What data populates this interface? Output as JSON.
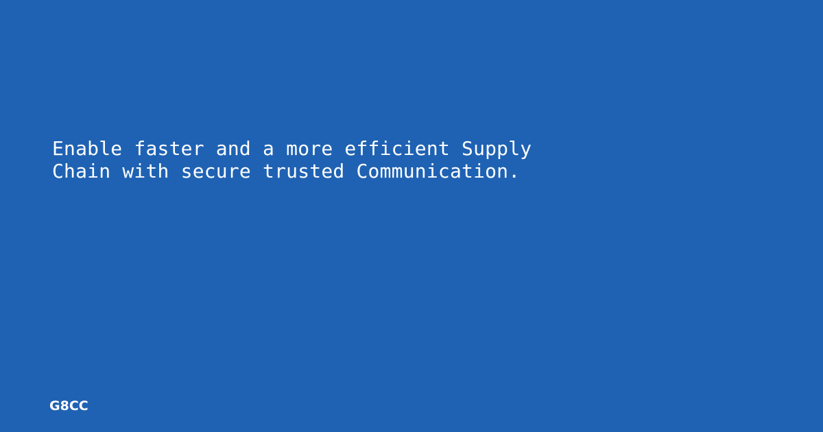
{
  "colors": {
    "background": "#1f62b3",
    "text": "#ffffff"
  },
  "headline": {
    "text": "Enable faster and a more efficient Supply\nChain with secure trusted Communication."
  },
  "brand": {
    "name": "G8CC"
  }
}
